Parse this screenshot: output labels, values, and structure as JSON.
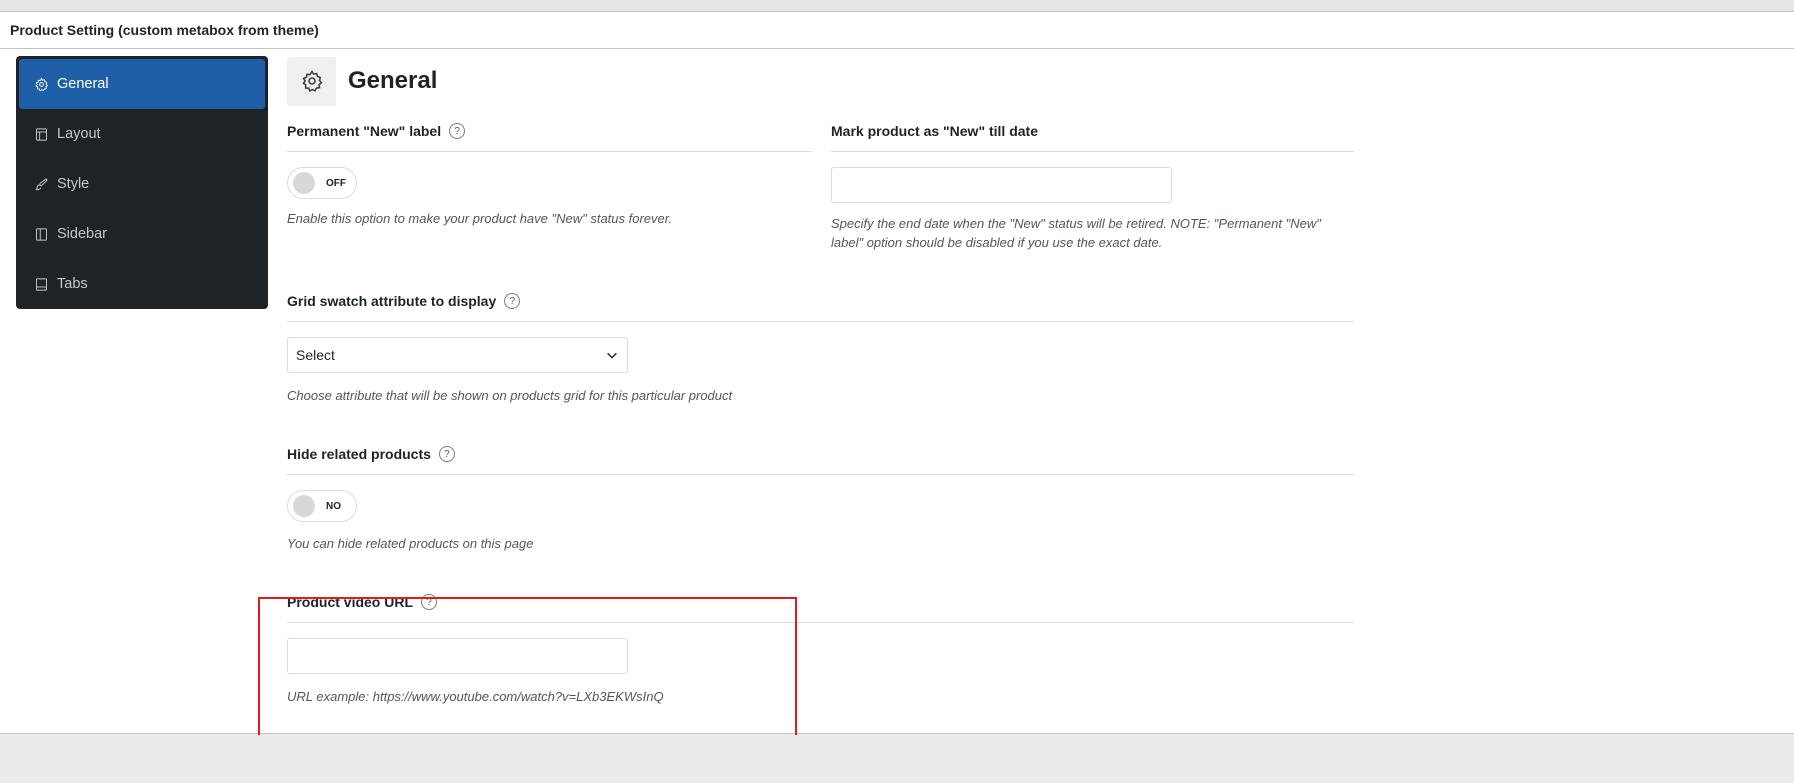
{
  "metabox": {
    "title": "Product Setting (custom metabox from theme)"
  },
  "sidebar": {
    "items": [
      {
        "label": "General",
        "icon": "gear-icon",
        "active": true
      },
      {
        "label": "Layout",
        "icon": "layout-icon",
        "active": false
      },
      {
        "label": "Style",
        "icon": "brush-icon",
        "active": false
      },
      {
        "label": "Sidebar",
        "icon": "sidebar-icon",
        "active": false
      },
      {
        "label": "Tabs",
        "icon": "tabs-icon",
        "active": false
      }
    ]
  },
  "section": {
    "title": "General",
    "icon": "gear-icon"
  },
  "fields": {
    "permanent_new": {
      "label": "Permanent \"New\" label",
      "toggle_state": "OFF",
      "description": "Enable this option to make your product have \"New\" status forever."
    },
    "new_till_date": {
      "label": "Mark product as \"New\" till date",
      "value": "",
      "description": "Specify the end date when the \"New\" status will be retired. NOTE: \"Permanent \"New\" label\" option should be disabled if you use the exact date."
    },
    "grid_swatch": {
      "label": "Grid swatch attribute to display",
      "selected": "Select",
      "description": "Choose attribute that will be shown on products grid for this particular product"
    },
    "hide_related": {
      "label": "Hide related products",
      "toggle_state": "NO",
      "description": "You can hide related products on this page"
    },
    "video_url": {
      "label": "Product video URL",
      "value": "",
      "description": "URL example: https://www.youtube.com/watch?v=LXb3EKWsInQ"
    }
  },
  "help_glyph": "?",
  "colors": {
    "active_nav": "#1f5fa8",
    "sidebar_bg": "#1d2327",
    "highlight": "#e31b1b"
  }
}
